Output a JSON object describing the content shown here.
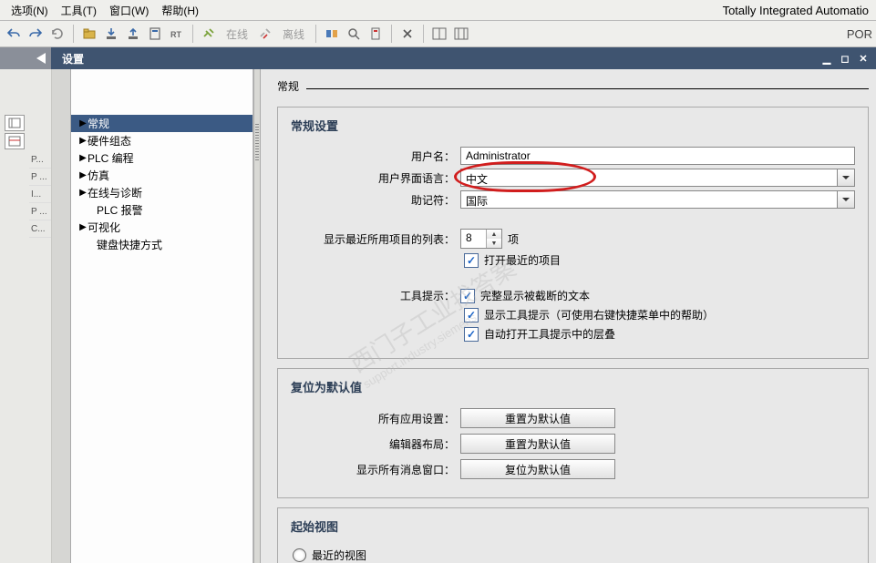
{
  "menu": {
    "options": "选项(N)",
    "tools": "工具(T)",
    "window": "窗口(W)",
    "help": "帮助(H)",
    "brand": "Totally Integrated Automatio",
    "brand2": "POR"
  },
  "toolbar": {
    "online": "在线",
    "offline": "离线"
  },
  "title": "设置",
  "lefttabs": [
    "P...",
    "P ...",
    "I...",
    "P ...",
    "C..."
  ],
  "nav": {
    "general": "常规",
    "hw": "硬件组态",
    "plcprog": "PLC 编程",
    "sim": "仿真",
    "onlinediag": "在线与诊断",
    "plcalarm": "PLC 报警",
    "vis": "可视化",
    "keyboard": "键盘快捷方式"
  },
  "content": {
    "h1": "常规",
    "general": {
      "title": "常规设置",
      "username_label": "用户名：",
      "username": "Administrator",
      "lang_label": "用户界面语言：",
      "lang": "中文",
      "mn_label": "助记符：",
      "mn": "国际",
      "recent_label": "显示最近所用项目的列表：",
      "recent_count": "8",
      "recent_suffix": "项",
      "openrecent": "打开最近的项目",
      "tooltip_label": "工具提示：",
      "tt1": "完整显示被截断的文本",
      "tt2": "显示工具提示（可使用右键快捷菜单中的帮助）",
      "tt3": "自动打开工具提示中的层叠"
    },
    "reset": {
      "title": "复位为默认值",
      "r1_label": "所有应用设置：",
      "r1_btn": "重置为默认值",
      "r2_label": "编辑器布局：",
      "r2_btn": "重置为默认值",
      "r3_label": "显示所有消息窗口：",
      "r3_btn": "复位为默认值"
    },
    "startview": {
      "title": "起始视图",
      "recent_view": "最近的视图"
    }
  },
  "watermark": {
    "a": "西门子工业找答案",
    "b": "support.industry.siemens"
  }
}
